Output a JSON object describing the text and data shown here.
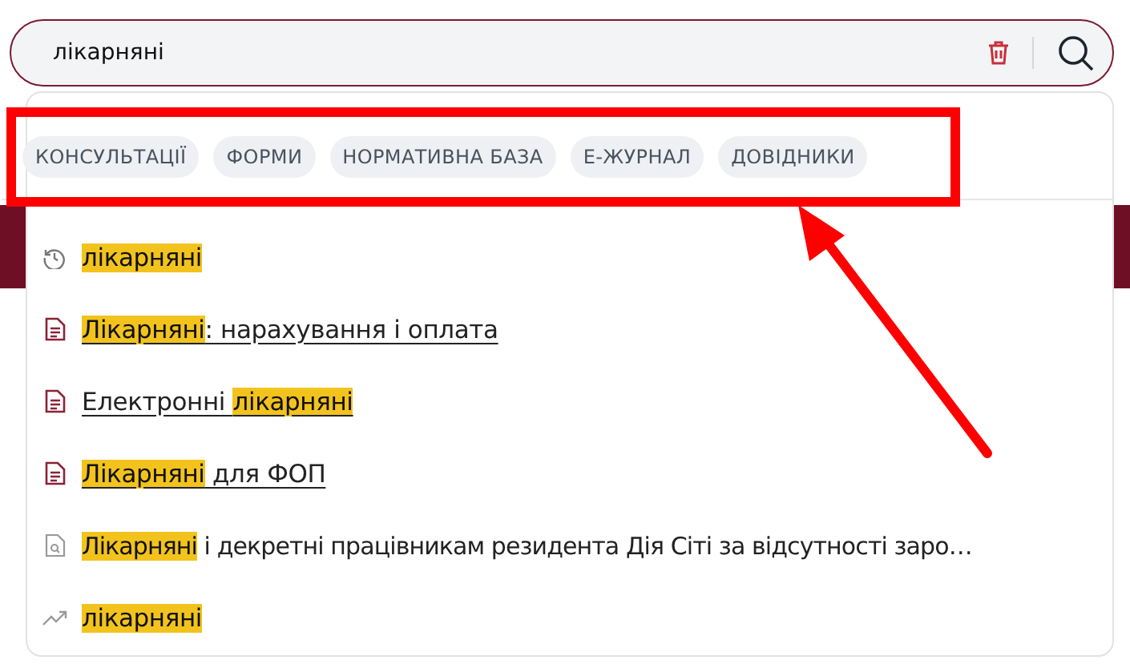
{
  "search": {
    "value": "лікарняні"
  },
  "categories": [
    {
      "label": "КОНСУЛЬТАЦІЇ"
    },
    {
      "label": "ФОРМИ"
    },
    {
      "label": "НОРМАТИВНА БАЗА"
    },
    {
      "label": "Е-ЖУРНАЛ"
    },
    {
      "label": "ДОВІДНИКИ"
    }
  ],
  "suggestions": [
    {
      "kind": "history",
      "underlined": false,
      "parts": [
        {
          "text": "лікарняні",
          "highlight": true
        }
      ]
    },
    {
      "kind": "document",
      "underlined": true,
      "parts": [
        {
          "text": "Лікарняні",
          "highlight": true
        },
        {
          "text": ": нарахування і оплата",
          "highlight": false
        }
      ]
    },
    {
      "kind": "document",
      "underlined": true,
      "parts": [
        {
          "text": "Електронні ",
          "highlight": false
        },
        {
          "text": "лікарняні",
          "highlight": true
        }
      ]
    },
    {
      "kind": "document",
      "underlined": true,
      "parts": [
        {
          "text": "Лікарняні",
          "highlight": true
        },
        {
          "text": " для ФОП",
          "highlight": false
        }
      ]
    },
    {
      "kind": "found",
      "underlined": false,
      "parts": [
        {
          "text": "Лікарняні",
          "highlight": true
        },
        {
          "text": " і декретні працівникам резидента Дія Сіті за відсутності заро…",
          "highlight": false
        }
      ]
    },
    {
      "kind": "trending",
      "underlined": false,
      "parts": [
        {
          "text": "лікарняні",
          "highlight": true
        }
      ]
    }
  ]
}
